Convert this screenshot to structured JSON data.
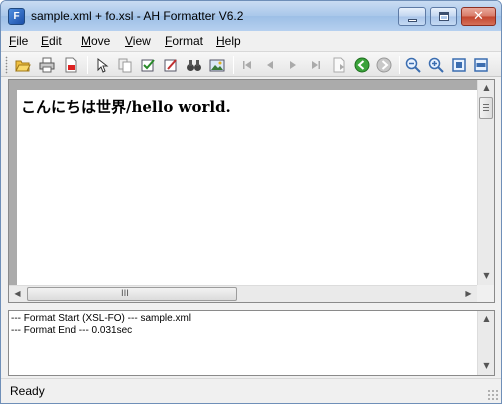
{
  "window": {
    "title": "sample.xml + fo.xsl - AH Formatter V6.2",
    "icon_letter": "F"
  },
  "menu": [
    {
      "label": "File",
      "mnemonic": "F",
      "rest": "ile"
    },
    {
      "label": "Edit",
      "mnemonic": "E",
      "rest": "dit"
    },
    {
      "label": "Move",
      "mnemonic": "M",
      "rest": "ove"
    },
    {
      "label": "View",
      "mnemonic": "V",
      "rest": "iew"
    },
    {
      "label": "Format",
      "mnemonic": "F",
      "rest": "ormat"
    },
    {
      "label": "Help",
      "mnemonic": "H",
      "rest": "elp"
    }
  ],
  "toolbar": {
    "icons": [
      "open-folder-icon",
      "print-icon",
      "pdf-icon",
      "select-tool-icon",
      "copy-icon",
      "edit-check-icon",
      "edit-note-icon",
      "find-binoculars-icon",
      "image-icon",
      "first-page-icon",
      "previous-page-icon",
      "next-page-icon",
      "last-page-icon",
      "goto-page-icon",
      "back-green-icon",
      "forward-gray-icon",
      "zoom-out-icon",
      "zoom-in-icon",
      "fit-page-icon",
      "fit-width-icon"
    ]
  },
  "document": {
    "text": "こんにちは世界/hello world."
  },
  "scrollbar": {
    "h_grip": "III"
  },
  "log": {
    "lines": [
      "--- Format Start (XSL-FO) --- sample.xml",
      "--- Format End ---  0.031sec"
    ]
  },
  "status": {
    "text": "Ready"
  },
  "colors": {
    "titlebar": "#a9c7ea",
    "close_button": "#c2452e",
    "doc_background": "#ababab",
    "green_nav": "#3aa33a"
  }
}
